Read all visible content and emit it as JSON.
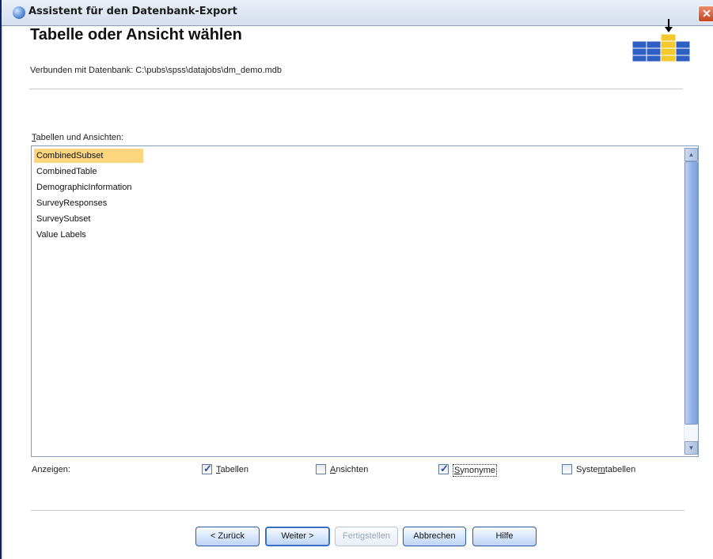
{
  "window": {
    "title": "Assistent für den Datenbank-Export"
  },
  "header": {
    "title": "Tabelle oder Ansicht wählen",
    "connection_text": "Verbunden mit Datenbank: C:\\pubs\\spss\\datajobs\\dm_demo.mdb"
  },
  "list": {
    "label_mnemonic": "T",
    "label_rest": "abellen und Ansichten:",
    "items": [
      "CombinedSubset",
      "CombinedTable",
      "DemographicInformation",
      "SurveyResponses",
      "SurveySubset",
      "Value Labels"
    ],
    "selected_index": 0
  },
  "show": {
    "label": "Anzeigen:",
    "options": [
      {
        "pre": "",
        "mnemonic": "T",
        "post": "abellen",
        "checked": true
      },
      {
        "pre": "",
        "mnemonic": "A",
        "post": "nsichten",
        "checked": false
      },
      {
        "pre": "",
        "mnemonic": "S",
        "post": "ynonyme",
        "checked": true
      },
      {
        "pre": "Syste",
        "mnemonic": "m",
        "post": "tabellen",
        "checked": false
      }
    ]
  },
  "buttons": {
    "back": "< Zurück",
    "next": "Weiter >",
    "finish": "Fertigstellen",
    "cancel": "Abbrechen",
    "help": "Hilfe"
  },
  "colors": {
    "selection": "#fcd57d",
    "title_bar": "#d6dfee",
    "close_button": "#c5451f",
    "button_border": "#2b5aa8"
  }
}
